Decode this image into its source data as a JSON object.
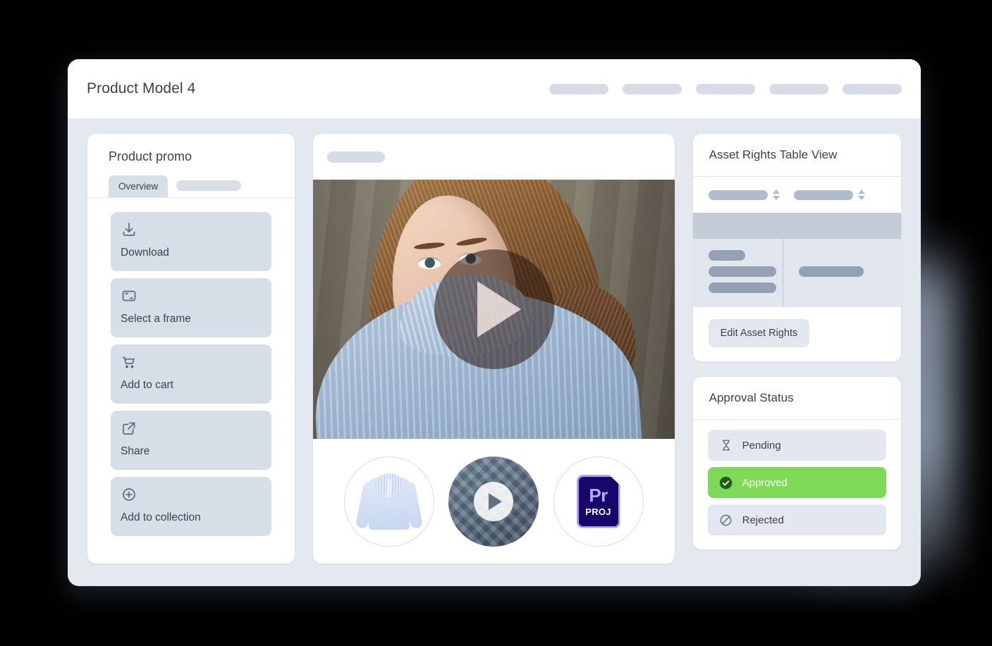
{
  "window": {
    "title": "Product Model 4",
    "nav_placeholders": [
      {
        "name": "nav-placeholder-1"
      },
      {
        "name": "nav-placeholder-2"
      },
      {
        "name": "nav-placeholder-3"
      },
      {
        "name": "nav-placeholder-4"
      },
      {
        "name": "nav-placeholder-5"
      }
    ]
  },
  "left_panel": {
    "title": "Product promo",
    "tabs": [
      {
        "label": "Overview",
        "active": true
      },
      {
        "label": "",
        "active": false,
        "placeholder": true
      }
    ],
    "actions": [
      {
        "label": "Download",
        "icon": "download-icon"
      },
      {
        "label": "Select a frame",
        "icon": "frame-select-icon"
      },
      {
        "label": "Add to cart",
        "icon": "shopping-cart-icon"
      },
      {
        "label": "Share",
        "icon": "share-external-icon"
      },
      {
        "label": "Add to collection",
        "icon": "plus-circle-icon"
      }
    ]
  },
  "media_panel": {
    "header_placeholder": "",
    "video": {
      "play_button": "play-button",
      "alt": "Model wearing light blue knit turtleneck sweater"
    },
    "thumbnails": [
      {
        "name": "thumbnail-product-sweater",
        "type": "image",
        "label": ""
      },
      {
        "name": "thumbnail-video",
        "type": "video",
        "label": ""
      },
      {
        "name": "thumbnail-premiere-project",
        "type": "file",
        "label": "Pr",
        "sublabel": "PROJ"
      }
    ]
  },
  "rights_panel": {
    "title": "Asset Rights Table View",
    "columns": [
      {
        "name": "column-1",
        "label": "",
        "sortable": true
      },
      {
        "name": "column-2",
        "label": "",
        "sortable": true
      }
    ],
    "rows": [
      {
        "cell_1_bars": 3,
        "cell_2_bars": 1
      }
    ],
    "edit_button": "Edit Asset Rights"
  },
  "approval_panel": {
    "title": "Approval Status",
    "statuses": [
      {
        "label": "Pending",
        "icon": "hourglass-icon",
        "selected": false
      },
      {
        "label": "Approved",
        "icon": "check-circle-icon",
        "selected": true
      },
      {
        "label": "Rejected",
        "icon": "ban-icon",
        "selected": false
      }
    ],
    "selected_color": "#7ed957"
  },
  "colors": {
    "window_bg": "#e4e9f0",
    "card_bg": "#ffffff",
    "text": "#39434f",
    "placeholder": "#d6dce5",
    "skeleton": "#94a1b4",
    "table_band": "#c3cbd7",
    "approved_green": "#7ed957",
    "premiere_navy": "#18066b",
    "premiere_accent": "#b3a7f7"
  }
}
